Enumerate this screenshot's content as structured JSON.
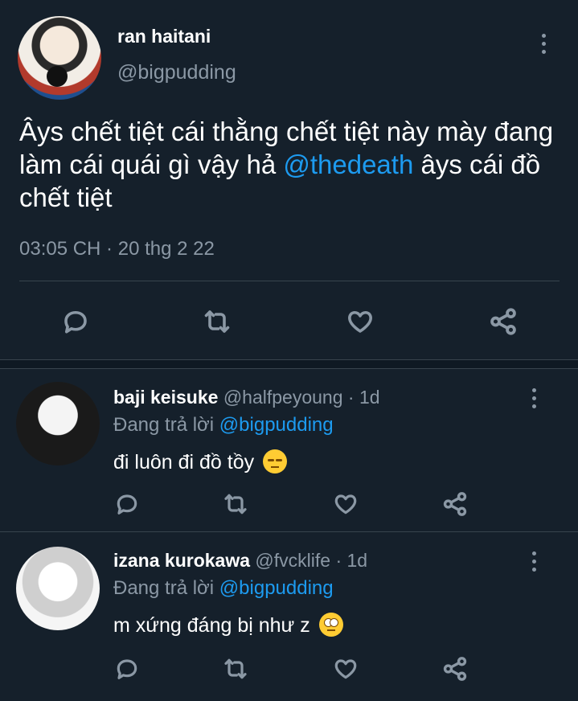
{
  "main_tweet": {
    "name": "ran haitani",
    "handle": "@bigpudding",
    "text_part1": "Âys chết tiệt cái thằng chết tiệt này mày đang làm cái quái gì vậy hả ",
    "mention": "@thedeath",
    "text_part2": " âys cái đồ chết tiệt",
    "timestamp": "03:05 CH · 20 thg 2 22",
    "actions": [
      "reply-icon",
      "retweet-icon",
      "like-icon",
      "share-icon"
    ]
  },
  "replies": [
    {
      "name": "baji keisuke",
      "handle": "@halfpeyoung",
      "time": "· 1d",
      "replying_label": "Đang trả lời",
      "replying_to": "@bigpudding",
      "text": "đi luôn đi đồ tồy",
      "emoji": "pensive-face-emoji"
    },
    {
      "name": "izana kurokawa",
      "handle": "@fvcklife",
      "time": "· 1d",
      "replying_label": "Đang trả lời",
      "replying_to": "@bigpudding",
      "text": "m xứng đáng bị như z",
      "emoji": "eye-roll-face-emoji"
    }
  ],
  "colors": {
    "background": "#15202b",
    "accent": "#1d9bf0",
    "muted": "#8b98a5",
    "divider": "#38444d"
  }
}
